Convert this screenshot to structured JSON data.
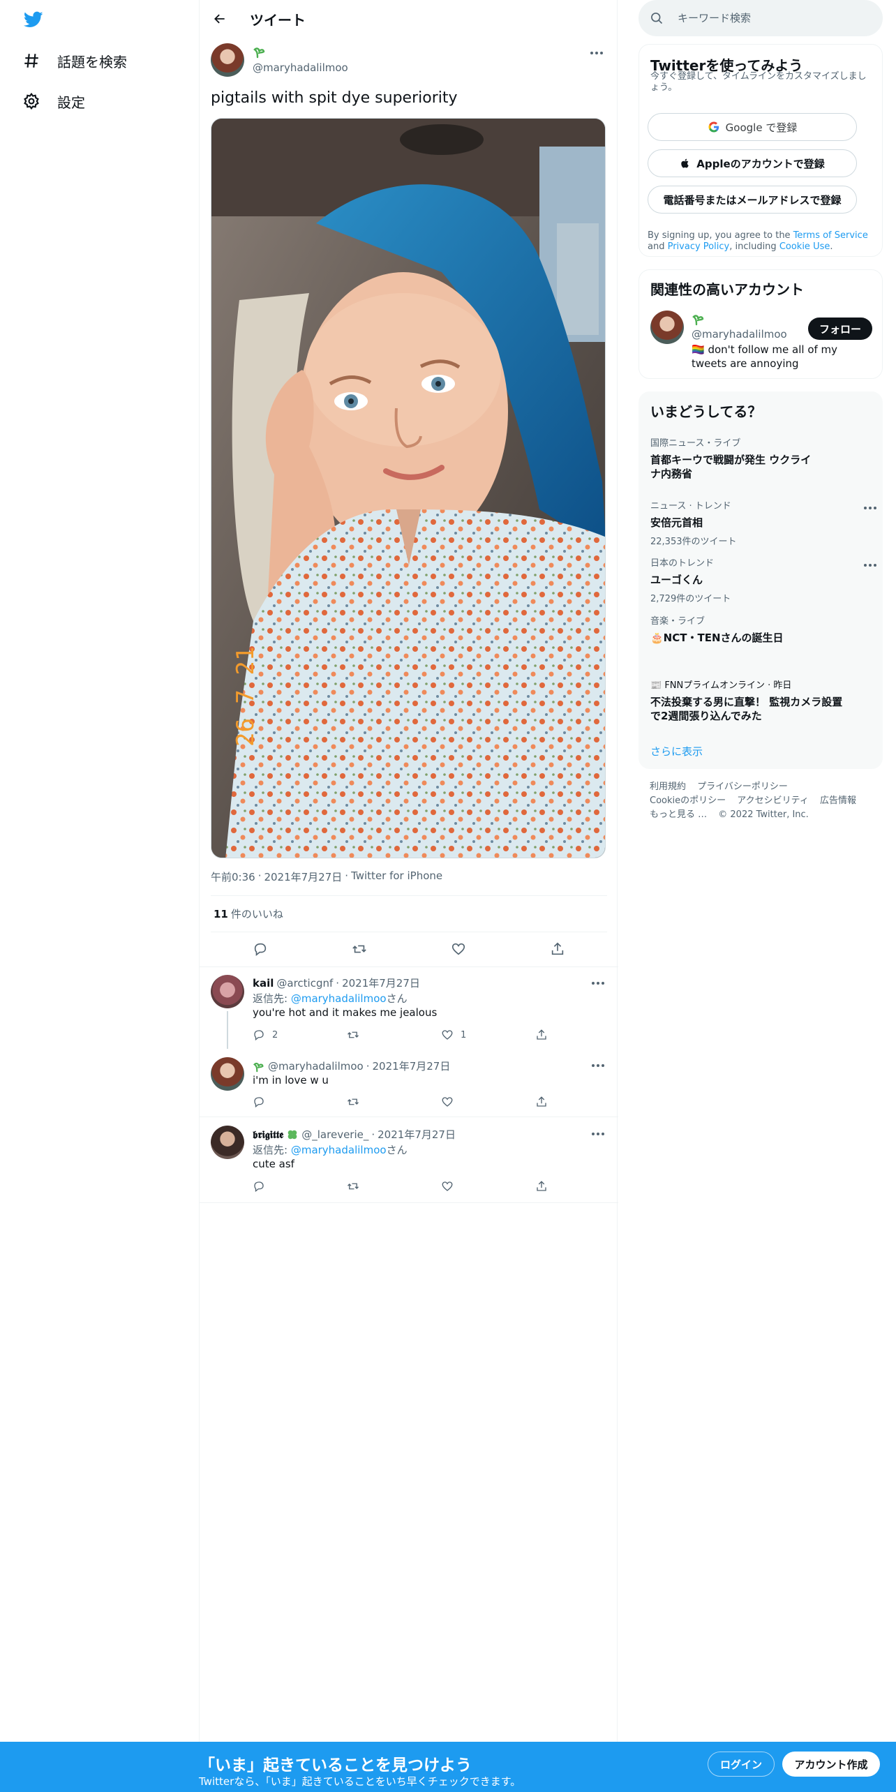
{
  "colors": {
    "brand": "#1d9bf0",
    "text": "#0f1419",
    "muted": "#536471"
  },
  "left_nav": {
    "items": [
      {
        "label": "話題を検索",
        "icon": "hashtag-icon"
      },
      {
        "label": "設定",
        "icon": "gear-icon"
      }
    ]
  },
  "header": {
    "title": "ツイート"
  },
  "tweet": {
    "handle": "@maryhadalilmoo",
    "text": "pigtails with spit dye superiority",
    "photo_stamp": "26 7 21",
    "time": "午前0:36",
    "date": "2021年7月27日",
    "source": "Twitter for iPhone",
    "dot": "·",
    "likes_count": "11",
    "likes_label": "件のいいね"
  },
  "replies": [
    {
      "name": "kail",
      "handle": "@arcticgnf",
      "date": "2021年7月27日",
      "reply_prefix": "返信先: ",
      "reply_to": "@maryhadalilmoo",
      "reply_suffix": "さん",
      "text": "you're hot and it makes me jealous",
      "reply_count": "2",
      "retweet_count": "",
      "like_count": "1"
    },
    {
      "name": "",
      "handle": "@maryhadalilmoo",
      "date": "2021年7月27日",
      "text": "i'm in love w u"
    },
    {
      "name": "𝖇𝖗𝖎𝖌𝖎𝖙𝖙𝖊",
      "handle": "@_lareverie_",
      "date": "2021年7月27日",
      "reply_prefix": "返信先: ",
      "reply_to": "@maryhadalilmoo",
      "reply_suffix": "さん",
      "text": "cute asf"
    }
  ],
  "search": {
    "placeholder": "キーワード検索"
  },
  "signup": {
    "title": "Twitterを使ってみよう",
    "subtitle": "今すぐ登録して、タイムラインをカスタマイズしましょう。",
    "google": "Google で登録",
    "apple": "Appleのアカウントで登録",
    "phone": "電話番号またはメールアドレスで登録",
    "terms_prefix": "By signing up, you agree to the ",
    "terms_link": "Terms of Service",
    "terms_and": " and ",
    "privacy_link": "Privacy Policy",
    "terms_including": ", including ",
    "cookie_link": "Cookie Use",
    "terms_end": "."
  },
  "related": {
    "title": "関連性の高いアカウント",
    "handle": "@maryhadalilmoo",
    "bio": "🏳️‍🌈 don't follow me all of my tweets are annoying",
    "follow": "フォロー"
  },
  "trends": {
    "title": "いまどうしてる？",
    "items": [
      {
        "category": "国際ニュース・ライブ",
        "topic": "首都キーウで戦闘が発生 ウクライナ内務省",
        "count": ""
      },
      {
        "category": "ニュース · トレンド",
        "topic": "安倍元首相",
        "count": "22,353件のツイート"
      },
      {
        "category": "日本のトレンド",
        "topic": "ユーゴくん",
        "count": "2,729件のツイート"
      },
      {
        "category": "音楽・ライブ",
        "topic": "🎂NCT・TENさんの誕生日",
        "count": ""
      },
      {
        "category": "📰 FNNプライムオンライン · 昨日",
        "topic": "不法投棄する男に直撃！ 監視カメラ設置で2週間張り込んでみた",
        "count": ""
      }
    ],
    "show_more": "さらに表示"
  },
  "footer": {
    "links": [
      "利用規約",
      "プライバシーポリシー",
      "Cookieのポリシー",
      "アクセシビリティ",
      "広告情報",
      "もっと見る …"
    ],
    "copyright": "© 2022 Twitter, Inc."
  },
  "banner": {
    "headline": "「いま」起きていることを見つけよう",
    "sub": "Twitterなら、「いま」起きていることをいち早くチェックできます。",
    "login": "ログイン",
    "signup": "アカウント作成"
  }
}
